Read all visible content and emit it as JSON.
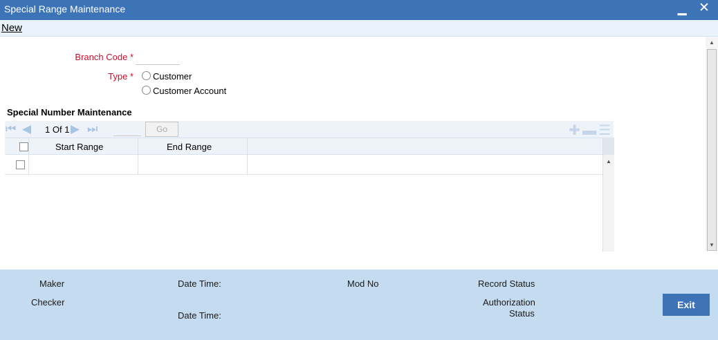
{
  "window": {
    "title": "Special Range Maintenance",
    "minimize_glyph": "▬",
    "close_glyph": "✕"
  },
  "menu": {
    "new_label": "New"
  },
  "form": {
    "branch_code_label": "Branch Code",
    "branch_code_value": "",
    "type_label": "Type",
    "required_mark": "*",
    "type_options": [
      "Customer",
      "Customer Account"
    ]
  },
  "section": {
    "title": "Special Number Maintenance",
    "pagination": {
      "current": "1",
      "of_label": "Of",
      "total": "1",
      "go_label": "Go"
    },
    "columns": [
      "Start Range",
      "End Range"
    ],
    "rows": [
      {
        "start_range": "",
        "end_range": ""
      }
    ]
  },
  "footer": {
    "maker_label": "Maker",
    "checker_label": "Checker",
    "date_time_label": "Date Time:",
    "mod_no_label": "Mod No",
    "record_status_label": "Record Status",
    "authorization_label": "Authorization",
    "status_label": "Status",
    "exit_label": "Exit"
  },
  "colors": {
    "titlebar": "#3d74b8",
    "required_label": "#c8102e",
    "footer_bg": "#c5dbef"
  }
}
